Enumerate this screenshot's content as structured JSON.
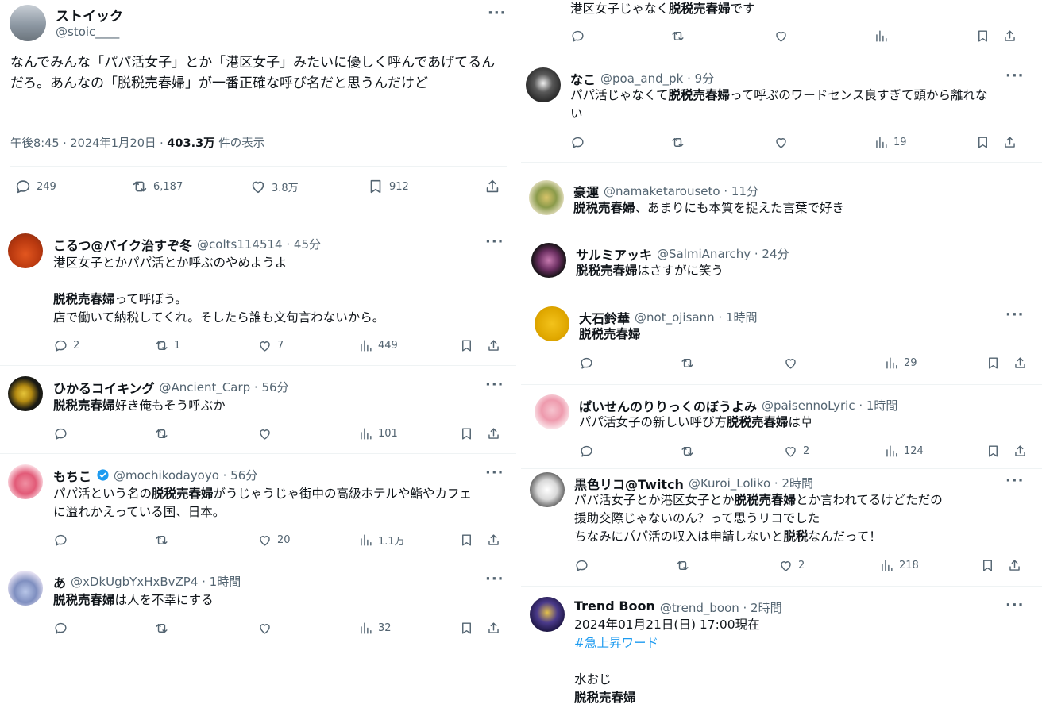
{
  "main_tweet": {
    "name": "ストイック",
    "handle": "@stoic____",
    "text": "なんでみんな「パパ活女子」とか「港区女子」みたいに優しく呼んであげてるんだろ。あんなの「脱税売春婦」が一番正確な呼び名だと思うんだけど",
    "time": "午後8:45 · 2024年1月20日 · ",
    "views": "403.3万",
    "views_label": " 件の表示",
    "replies": "249",
    "retweets": "6,187",
    "likes": "3.8万",
    "bookmarks": "912"
  },
  "left_replies": [
    {
      "name": "こるつ@バイク治すぞ冬",
      "handle": "@colts114514 · 45分",
      "lines": [
        "港区女子とかパパ活とか呼ぶのやめようよ",
        "",
        "[b]脱税売春婦[/b]って呼ぼう。",
        "店で働いて納税してくれ。そしたら誰も文句言わないから。"
      ],
      "replies": "2",
      "retweets": "1",
      "likes": "7",
      "views": "449"
    },
    {
      "name": "ひかるコイキング",
      "handle": "@Ancient_Carp · 56分",
      "lines": [
        "[b]脱税売春婦[/b]好き俺もそう呼ぶか"
      ],
      "replies": "",
      "retweets": "",
      "likes": "",
      "views": "101"
    },
    {
      "name": "もちこ",
      "handle": "@mochikodayoyo · 56分",
      "lines": [
        "パパ活という名の[b]脱税売春婦[/b]がうじゃうじゃ街中の高級ホテルや鮨やカフェ",
        "に溢れかえっている国、日本。"
      ],
      "replies": "",
      "retweets": "",
      "likes": "20",
      "views": "1.1万"
    },
    {
      "name": "あ",
      "handle": "@xDkUgbYxHxBvZP4 · 1時間",
      "lines": [
        "[b]脱税売春婦[/b]は人を不幸にする"
      ],
      "replies": "",
      "retweets": "",
      "likes": "",
      "views": "32"
    }
  ],
  "right_top_fragment": {
    "lines": [
      "港区女子じゃなく[b]脱税売春婦[/b]です"
    ]
  },
  "right_replies": [
    {
      "name": "なこ",
      "handle": "@poa_and_pk · 9分",
      "lines": [
        "パパ活じゃなくて[b]脱税売春婦[/b]って呼ぶのワードセンス良すぎて頭から離れな",
        "い"
      ],
      "replies": "",
      "retweets": "",
      "likes": "",
      "views": "19"
    },
    {
      "name": "豪運",
      "handle": "@namaketarouseto · 11分",
      "lines": [
        "[b]脱税売春婦[/b]、あまりにも本質を捉えた言葉で好き"
      ]
    },
    {
      "name": "サルミアッキ",
      "handle": "@SalmiAnarchy · 24分",
      "lines": [
        "[b]脱税売春婦[/b]はさすがに笑う"
      ]
    },
    {
      "name": "大石鈴華",
      "handle": "@not_ojisann · 1時間",
      "lines": [
        "[b]脱税売春婦[/b]"
      ],
      "replies": "",
      "retweets": "",
      "likes": "",
      "views": "29"
    },
    {
      "name": "ぱいせんのりりっくのぼうよみ",
      "handle": "@paisennoLyric · 1時間",
      "lines": [
        "パパ活女子の新しい呼び方[b]脱税売春婦[/b]は草"
      ],
      "replies": "",
      "retweets": "",
      "likes": "2",
      "views": "124"
    },
    {
      "name": "黒色リコ@Twitch",
      "handle": "@Kuroi_Loliko · 2時間",
      "lines": [
        "パパ活女子とか港区女子とか[b]脱税売春婦[/b]とか言われてるけどただの",
        "援助交際じゃないのん？って思うリコでした",
        "ちなみにパパ活の収入は申請しないと[b]脱税[/b]なんだって！"
      ],
      "replies": "",
      "retweets": "",
      "likes": "2",
      "views": "218"
    },
    {
      "name": "Trend Boon",
      "handle": "@trend_boon · 2時間",
      "lines": [
        "2024年01月21日(日) 17:00現在",
        "[h]#急上昇ワード[/h]",
        "",
        "水おじ",
        "[b]脱税売春婦[/b]"
      ]
    }
  ],
  "more_label": "···",
  "colors": {
    "text": "#0f1419",
    "secondary": "#536471",
    "link": "#1d9bf0",
    "border": "#eff3f4"
  }
}
